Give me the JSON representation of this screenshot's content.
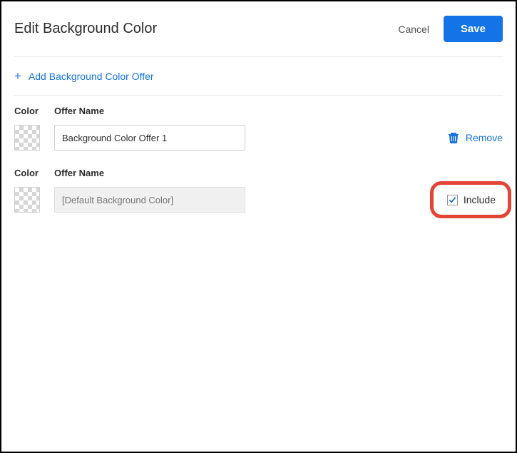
{
  "header": {
    "title": "Edit Background Color",
    "cancel_label": "Cancel",
    "save_label": "Save"
  },
  "add_link": {
    "label": "Add Background Color Offer"
  },
  "columns": {
    "color_label": "Color",
    "name_label": "Offer Name"
  },
  "offers": [
    {
      "name_value": "Background Color Offer 1",
      "remove_label": "Remove"
    }
  ],
  "default_offer": {
    "placeholder": "[Default Background Color]",
    "include_label": "Include",
    "include_checked": true
  }
}
